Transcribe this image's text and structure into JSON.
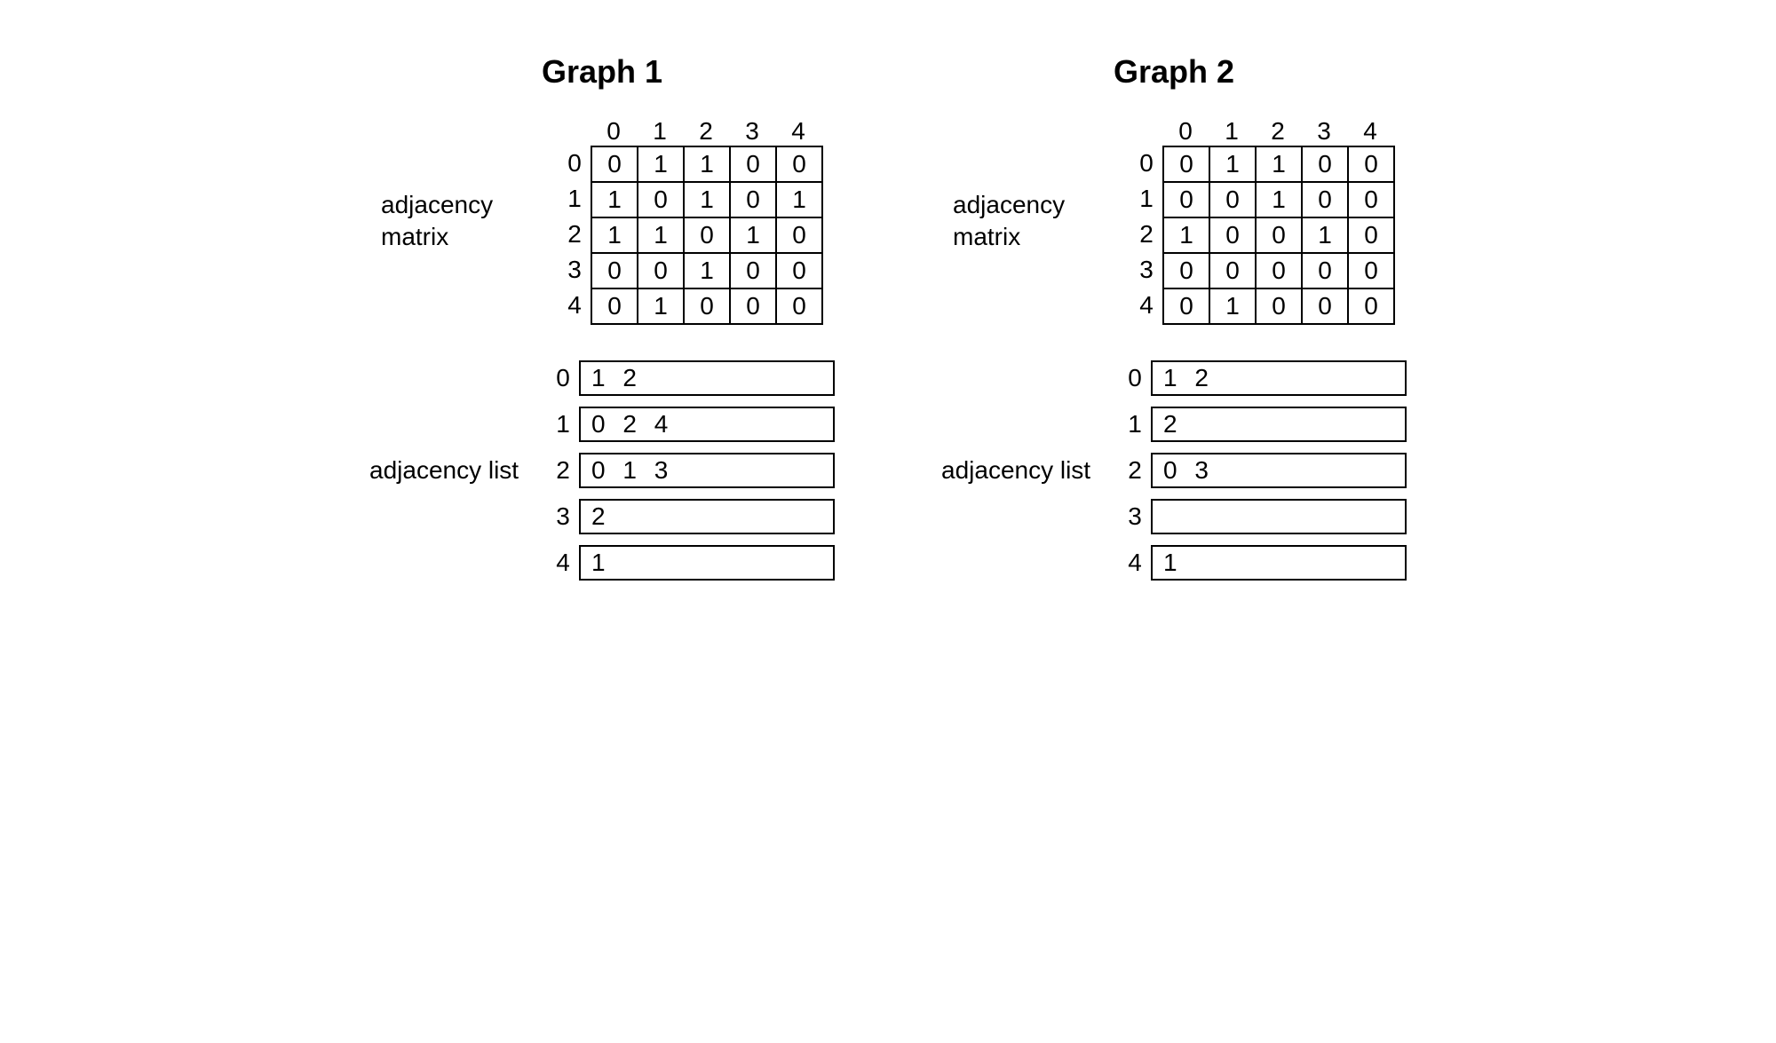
{
  "graph1": {
    "title": "Graph 1",
    "matrix_label": "adjacency matrix",
    "list_label": "adjacency list",
    "matrix": {
      "col_headers": [
        "0",
        "1",
        "2",
        "3",
        "4"
      ],
      "row_headers": [
        "0",
        "1",
        "2",
        "3",
        "4"
      ],
      "rows": [
        [
          "0",
          "1",
          "1",
          "0",
          "0"
        ],
        [
          "1",
          "0",
          "1",
          "0",
          "1"
        ],
        [
          "1",
          "1",
          "0",
          "1",
          "0"
        ],
        [
          "0",
          "0",
          "1",
          "0",
          "0"
        ],
        [
          "0",
          "1",
          "0",
          "0",
          "0"
        ]
      ]
    },
    "list": [
      {
        "idx": "0",
        "vals": "1 2"
      },
      {
        "idx": "1",
        "vals": "0 2 4"
      },
      {
        "idx": "2",
        "vals": "0 1 3"
      },
      {
        "idx": "3",
        "vals": "2"
      },
      {
        "idx": "4",
        "vals": "1"
      }
    ]
  },
  "graph2": {
    "title": "Graph 2",
    "matrix_label": "adjacency matrix",
    "list_label": "adjacency list",
    "matrix": {
      "col_headers": [
        "0",
        "1",
        "2",
        "3",
        "4"
      ],
      "row_headers": [
        "0",
        "1",
        "2",
        "3",
        "4"
      ],
      "rows": [
        [
          "0",
          "1",
          "1",
          "0",
          "0"
        ],
        [
          "0",
          "0",
          "1",
          "0",
          "0"
        ],
        [
          "1",
          "0",
          "0",
          "1",
          "0"
        ],
        [
          "0",
          "0",
          "0",
          "0",
          "0"
        ],
        [
          "0",
          "1",
          "0",
          "0",
          "0"
        ]
      ]
    },
    "list": [
      {
        "idx": "0",
        "vals": "1 2"
      },
      {
        "idx": "1",
        "vals": "2"
      },
      {
        "idx": "2",
        "vals": "0 3"
      },
      {
        "idx": "3",
        "vals": ""
      },
      {
        "idx": "4",
        "vals": "1"
      }
    ]
  }
}
